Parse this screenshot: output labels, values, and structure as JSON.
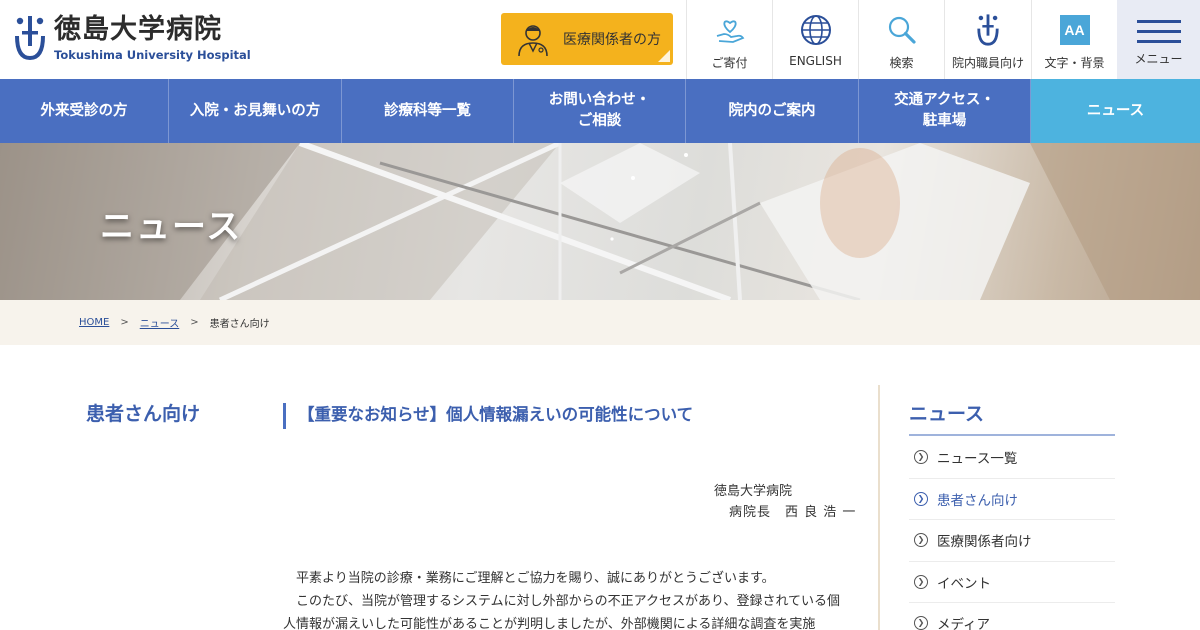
{
  "header": {
    "logo": {
      "name_ja": "徳島大学病院",
      "name_en": "Tokushima University Hospital"
    },
    "medical_button": "医療関係者の方",
    "utilities": [
      {
        "label": "ご寄付",
        "icon": "heart-hand-icon"
      },
      {
        "label": "ENGLISH",
        "icon": "globe-icon"
      },
      {
        "label": "検索",
        "icon": "search-icon"
      },
      {
        "label": "院内職員向け",
        "icon": "staff-logo-icon"
      },
      {
        "label": "文字・背景",
        "icon": "font-size-icon",
        "glyph": "AA"
      }
    ],
    "menu_label": "メニュー"
  },
  "nav": {
    "items": [
      {
        "line1": "外来受診の方",
        "line2": ""
      },
      {
        "line1": "入院・お見舞いの方",
        "line2": ""
      },
      {
        "line1": "診療科等一覧",
        "line2": ""
      },
      {
        "line1": "お問い合わせ・",
        "line2": "ご相談"
      },
      {
        "line1": "院内のご案内",
        "line2": ""
      },
      {
        "line1": "交通アクセス・",
        "line2": "駐車場"
      },
      {
        "line1": "ニュース",
        "line2": ""
      }
    ],
    "active_index": 6
  },
  "hero": {
    "title": "ニュース"
  },
  "breadcrumb": {
    "home": "HOME",
    "news": "ニュース",
    "current": "患者さん向け",
    "sep": ">"
  },
  "content": {
    "category": "患者さん向け",
    "title": "【重要なお知らせ】個人情報漏えいの可能性について",
    "sign_org": "徳島大学病院",
    "sign_person": "病院長　西 良 浩 一",
    "paragraphs": [
      "平素より当院の診療・業務にご理解とご協力を賜り、誠にありがとうございます。",
      "このたび、当院が管理するシステムに対し外部からの不正アクセスがあり、登録されている個人情報が漏えいした可能性があることが判明しましたが、外部機関による詳細な調査を実施"
    ]
  },
  "sidebar": {
    "title": "ニュース",
    "items": [
      "ニュース一覧",
      "患者さん向け",
      "医療関係者向け",
      "イベント",
      "メディア"
    ],
    "current_index": 1
  },
  "colors": {
    "brand_blue": "#4a6fc1",
    "active_nav": "#4db3df",
    "title_blue": "#3c5fae",
    "medical_yellow": "#f4b21d"
  }
}
